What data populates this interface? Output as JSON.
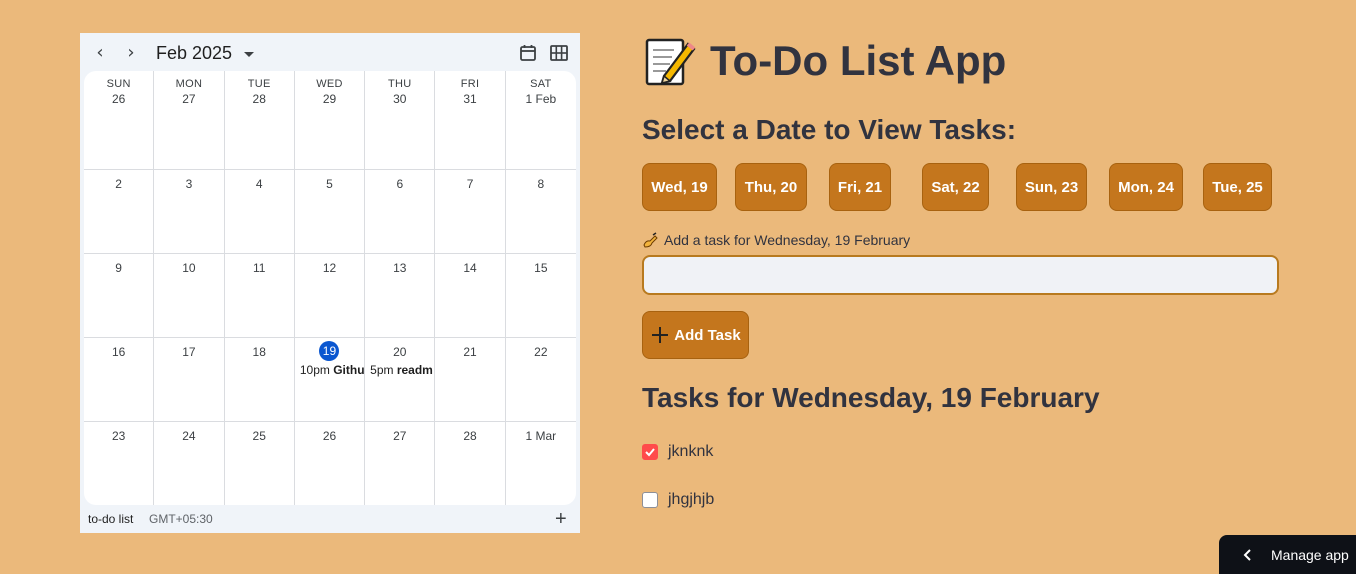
{
  "calendar": {
    "month_label": "Feb 2025",
    "weekdays": [
      "SUN",
      "MON",
      "TUE",
      "WED",
      "THU",
      "FRI",
      "SAT"
    ],
    "weeks": [
      [
        "26",
        "27",
        "28",
        "29",
        "30",
        "31",
        "1 Feb"
      ],
      [
        "2",
        "3",
        "4",
        "5",
        "6",
        "7",
        "8"
      ],
      [
        "9",
        "10",
        "11",
        "12",
        "13",
        "14",
        "15"
      ],
      [
        "16",
        "17",
        "18",
        "19",
        "20",
        "21",
        "22"
      ],
      [
        "23",
        "24",
        "25",
        "26",
        "27",
        "28",
        "1 Mar"
      ]
    ],
    "today": "19",
    "events": {
      "wed19": {
        "time": "10pm",
        "title": "Githu"
      },
      "thu20": {
        "time": "5pm",
        "title": "readm"
      }
    },
    "calendar_name": "to-do list",
    "timezone": "GMT+05:30"
  },
  "app": {
    "title": "To-Do List App",
    "select_heading": "Select a Date to View Tasks:",
    "day_buttons": [
      "Wed, 19",
      "Thu, 20",
      "Fri, 21",
      "Sat, 22",
      "Sun, 23",
      "Mon, 24",
      "Tue, 25"
    ],
    "input_label": "Add a task for Wednesday, 19 February",
    "input_value": "",
    "add_button": "Add Task",
    "tasks_heading": "Tasks for Wednesday, 19 February",
    "tasks": [
      {
        "label": "jknknk",
        "checked": true
      },
      {
        "label": "jhgjhjb",
        "checked": false
      }
    ]
  },
  "manage_app": "Manage app",
  "colors": {
    "background": "#ebb97b",
    "button": "#c4761d",
    "checkbox_checked": "#ff4b4b",
    "today_badge": "#0b57d0"
  }
}
